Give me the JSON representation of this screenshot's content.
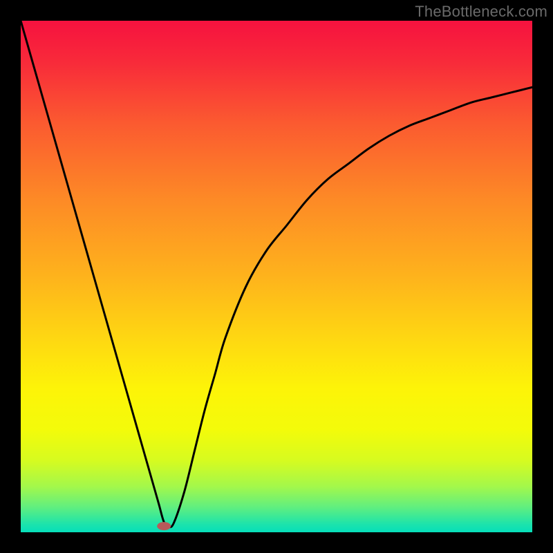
{
  "watermark": "TheBottleneck.com",
  "chart_data": {
    "type": "line",
    "title": "",
    "xlabel": "",
    "ylabel": "",
    "xlim": [
      0,
      100
    ],
    "ylim": [
      0,
      100
    ],
    "grid": false,
    "legend": false,
    "annotations": [],
    "series": [
      {
        "name": "bottleneck-curve",
        "x": [
          0,
          2,
          4,
          6,
          8,
          10,
          12,
          14,
          16,
          18,
          20,
          22,
          24,
          26,
          27,
          28,
          29,
          30,
          32,
          34,
          36,
          38,
          40,
          44,
          48,
          52,
          56,
          60,
          64,
          68,
          72,
          76,
          80,
          84,
          88,
          92,
          96,
          100
        ],
        "y": [
          100,
          93,
          86,
          79,
          72,
          65,
          58,
          51,
          44,
          37,
          30,
          23,
          16,
          9,
          5.5,
          2,
          1,
          2,
          8,
          16,
          24,
          31,
          38,
          48,
          55,
          60,
          65,
          69,
          72,
          75,
          77.5,
          79.5,
          81,
          82.5,
          84,
          85,
          86,
          87
        ]
      }
    ],
    "marker": {
      "name": "optimal-point",
      "x": 28,
      "y": 1.2,
      "color": "#b85a5a",
      "rx": 10,
      "ry": 6
    },
    "background_gradient": {
      "stops": [
        {
          "offset": 0.0,
          "color": "#f6123f"
        },
        {
          "offset": 0.08,
          "color": "#f82a3a"
        },
        {
          "offset": 0.2,
          "color": "#fb5a30"
        },
        {
          "offset": 0.35,
          "color": "#fd8a26"
        },
        {
          "offset": 0.5,
          "color": "#feb31c"
        },
        {
          "offset": 0.62,
          "color": "#fed712"
        },
        {
          "offset": 0.72,
          "color": "#fdf408"
        },
        {
          "offset": 0.8,
          "color": "#f3fb0a"
        },
        {
          "offset": 0.86,
          "color": "#d6fb20"
        },
        {
          "offset": 0.91,
          "color": "#a4f84a"
        },
        {
          "offset": 0.95,
          "color": "#62ef7e"
        },
        {
          "offset": 0.985,
          "color": "#1be3ac"
        },
        {
          "offset": 1.0,
          "color": "#06dfba"
        }
      ]
    }
  }
}
